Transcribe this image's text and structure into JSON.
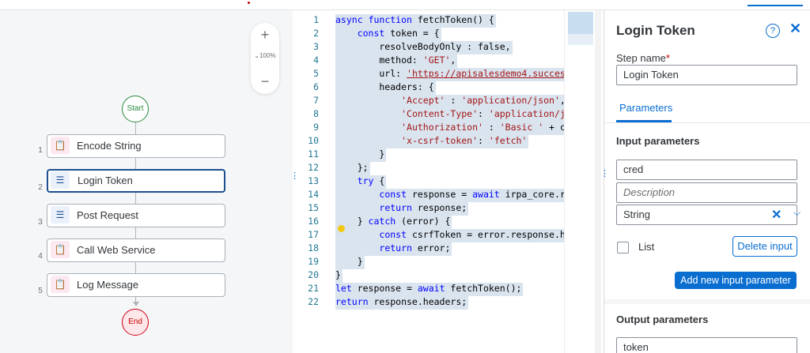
{
  "flow": {
    "zoom_in": "+",
    "zoom_level": "100%",
    "zoom_out": "−",
    "start_label": "Start",
    "end_label": "End",
    "steps": [
      {
        "num": "1",
        "label": "Encode String",
        "icon": "clipboard-icon",
        "glyph": "📋"
      },
      {
        "num": "2",
        "label": "Login Token",
        "icon": "list-icon",
        "glyph": "☰"
      },
      {
        "num": "3",
        "label": "Post Request",
        "icon": "list-icon",
        "glyph": "☰"
      },
      {
        "num": "4",
        "label": "Call Web Service",
        "icon": "clipboard-icon",
        "glyph": "📋"
      },
      {
        "num": "5",
        "label": "Log Message",
        "icon": "clipboard-icon",
        "glyph": "📋"
      }
    ]
  },
  "code": {
    "lines": [
      {
        "n": "1",
        "t": "async function fetchToken() {"
      },
      {
        "n": "2",
        "t": "    const token = {"
      },
      {
        "n": "3",
        "t": "        resolveBodyOnly : false,"
      },
      {
        "n": "4",
        "t": "        method: 'GET',"
      },
      {
        "n": "5",
        "t": "        url: 'https://apisalesdemo4.succes"
      },
      {
        "n": "6",
        "t": "        headers: {"
      },
      {
        "n": "7",
        "t": "            'Accept' : 'application/json',"
      },
      {
        "n": "8",
        "t": "            'Content-Type': 'application/j"
      },
      {
        "n": "9",
        "t": "            'Authorization' : 'Basic ' + c"
      },
      {
        "n": "10",
        "t": "            'x-csrf-token': 'fetch'"
      },
      {
        "n": "11",
        "t": "        }"
      },
      {
        "n": "12",
        "t": "    };"
      },
      {
        "n": "13",
        "t": "    try {"
      },
      {
        "n": "14",
        "t": "        const response = await irpa_core.r"
      },
      {
        "n": "15",
        "t": "        return response;"
      },
      {
        "n": "16",
        "t": "    } catch (error) {"
      },
      {
        "n": "17",
        "t": "        const csrfToken = error.response.h"
      },
      {
        "n": "18",
        "t": "        return error;"
      },
      {
        "n": "19",
        "t": "    }"
      },
      {
        "n": "20",
        "t": "}"
      },
      {
        "n": "21",
        "t": "let response = await fetchToken();"
      },
      {
        "n": "22",
        "t": "return response.headers;"
      }
    ]
  },
  "panel": {
    "title": "Login Token",
    "step_name_label": "Step name",
    "required_mark": "*",
    "step_name_value": "Login Token",
    "tab_parameters": "Parameters",
    "input_section_title": "Input parameters",
    "input_name_value": "cred",
    "description_placeholder": "Description",
    "type_value": "String",
    "list_label": "List",
    "delete_input_label": "Delete input",
    "add_input_label": "Add new input parameter",
    "output_section_title": "Output parameters",
    "output_name_value": "token"
  }
}
